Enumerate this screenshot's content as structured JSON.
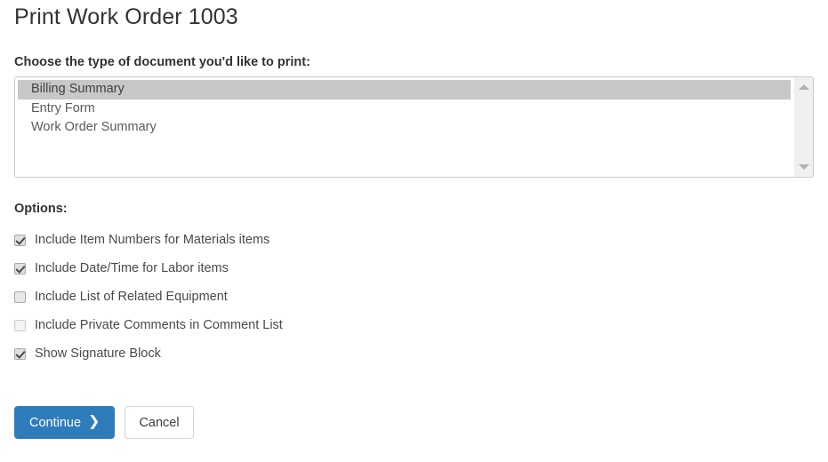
{
  "page": {
    "title": "Print Work Order 1003"
  },
  "document_type": {
    "label": "Choose the type of document you'd like to print:",
    "options": [
      {
        "label": "Billing Summary",
        "selected": true
      },
      {
        "label": "Entry Form",
        "selected": false
      },
      {
        "label": "Work Order Summary",
        "selected": false
      }
    ],
    "scrollbar": {
      "up_arrow_icon": "caret-up-icon",
      "down_arrow_icon": "caret-down-icon"
    }
  },
  "options": {
    "label": "Options:",
    "items": [
      {
        "label": "Include Item Numbers for Materials items",
        "checked": true,
        "dim": false
      },
      {
        "label": "Include Date/Time for Labor items",
        "checked": true,
        "dim": false
      },
      {
        "label": "Include List of Related Equipment",
        "checked": false,
        "dim": false
      },
      {
        "label": "Include Private Comments in Comment List",
        "checked": false,
        "dim": true
      },
      {
        "label": "Show Signature Block",
        "checked": true,
        "dim": false
      }
    ]
  },
  "actions": {
    "continue_label": "Continue",
    "continue_icon": "chevron-right-icon",
    "cancel_label": "Cancel"
  },
  "colors": {
    "primary": "#2f7cba",
    "selected_row": "#c8c8c8",
    "border": "#cccccc",
    "text": "#4a4a4a"
  }
}
